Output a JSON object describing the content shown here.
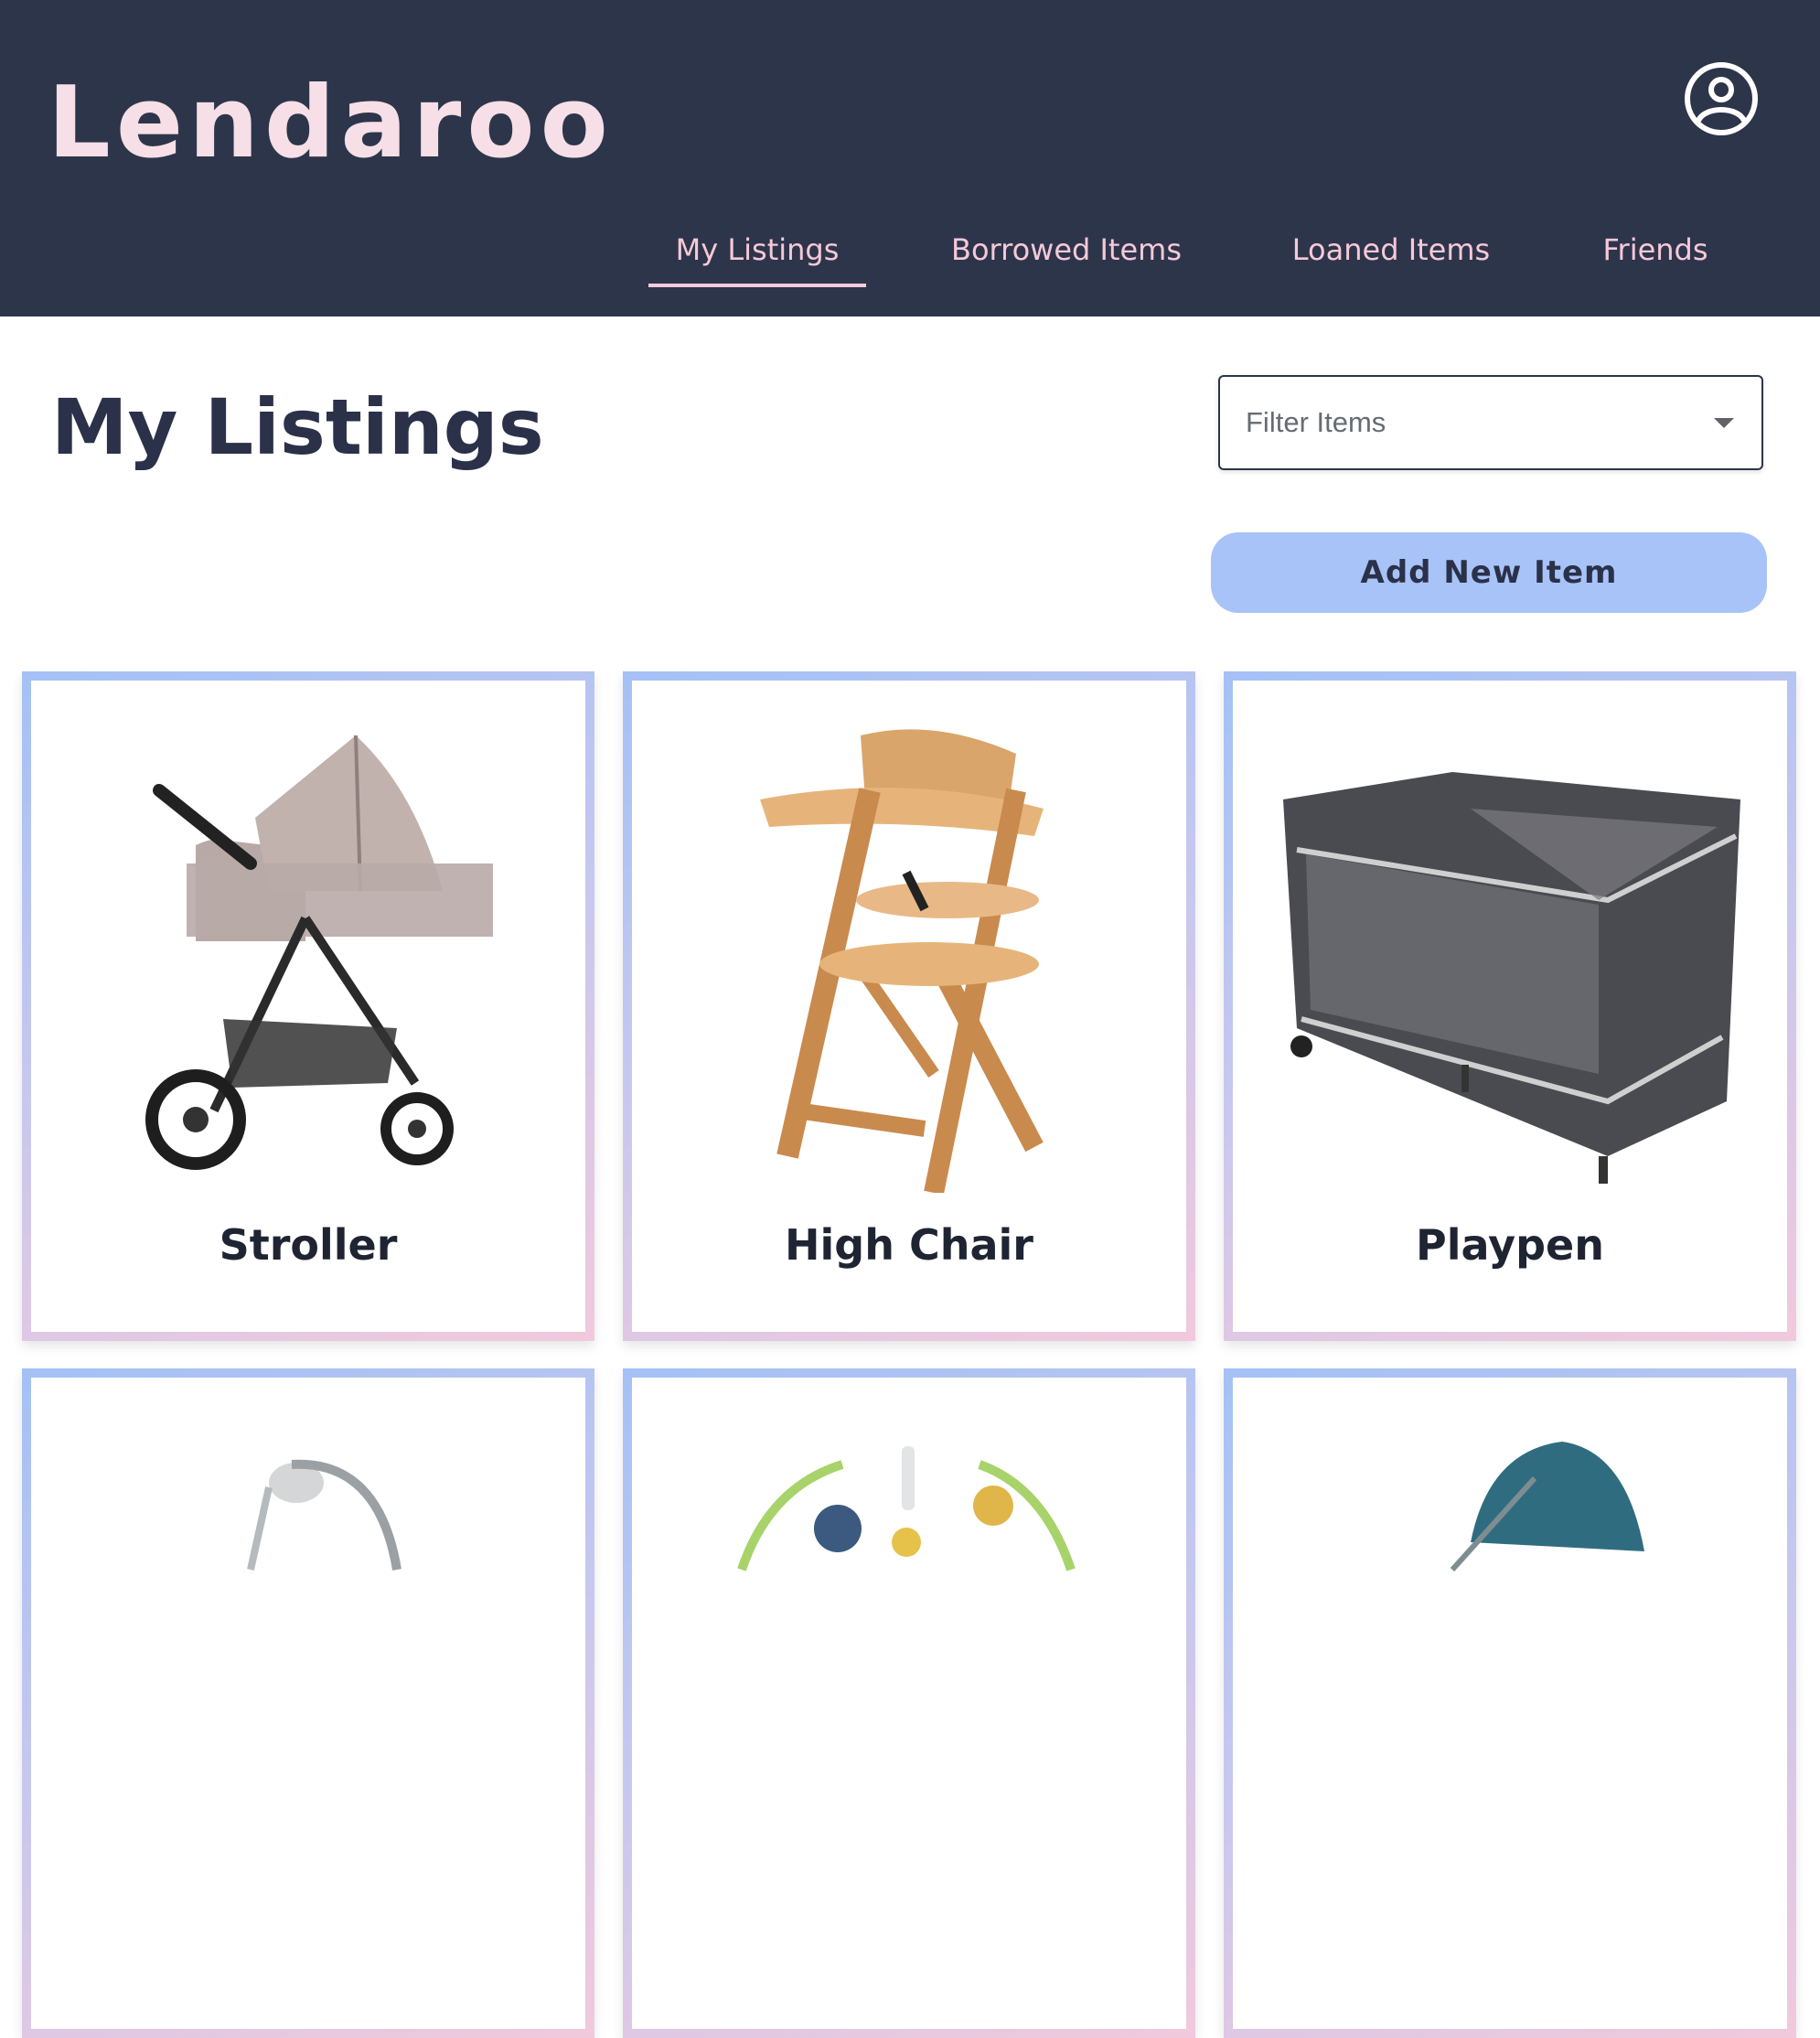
{
  "app": {
    "name": "Lendaroo"
  },
  "nav": {
    "items": [
      {
        "label": "My Listings",
        "active": true
      },
      {
        "label": "Borrowed Items",
        "active": false
      },
      {
        "label": "Loaned Items",
        "active": false
      },
      {
        "label": "Friends",
        "active": false
      }
    ]
  },
  "page": {
    "title": "My Listings"
  },
  "filter": {
    "placeholder": "Filter Items"
  },
  "actions": {
    "add_item_label": "Add New Item"
  },
  "listings": [
    {
      "label": "Stroller",
      "image": "stroller-image"
    },
    {
      "label": "High Chair",
      "image": "high-chair-image"
    },
    {
      "label": "Playpen",
      "image": "playpen-image"
    },
    {
      "label": "",
      "image": "baby-swing-image"
    },
    {
      "label": "",
      "image": "activity-gym-image"
    },
    {
      "label": "",
      "image": "bouncer-image"
    }
  ],
  "colors": {
    "header_bg": "#2d354b",
    "nav_text": "#f6c9d8",
    "button_bg": "#a8c3f7",
    "title_text": "#2a3149"
  }
}
